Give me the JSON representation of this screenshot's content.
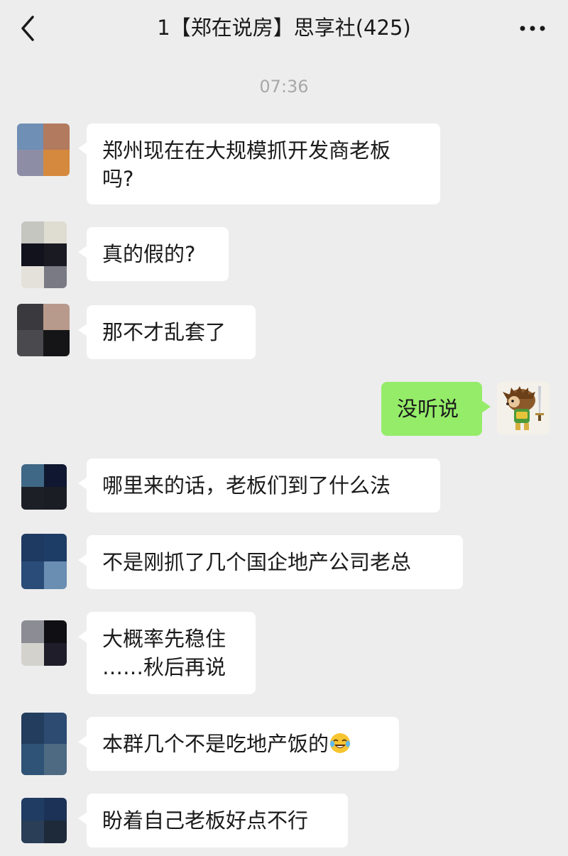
{
  "header": {
    "title": "1【郑在说房】思享社(425)",
    "back_icon": "chevron-left-icon",
    "more_icon": "more-horizontal-icon"
  },
  "timestamp": "07:36",
  "messages": [
    {
      "side": "left",
      "text": "郑州现在在大规模抓开发商老板\n吗?"
    },
    {
      "side": "left",
      "text": "真的假的?"
    },
    {
      "side": "left",
      "text": "那不才乱套了"
    },
    {
      "side": "right",
      "text": "没听说"
    },
    {
      "side": "left",
      "text": "哪里来的话，老板们到了什么法"
    },
    {
      "side": "left",
      "text": "不是刚抓了几个国企地产公司老总"
    },
    {
      "side": "left",
      "text": "大概率先稳住\n……秋后再说"
    },
    {
      "side": "left",
      "text": "本群几个不是吃地产饭的",
      "emoji": "face-with-tears-of-joy-icon"
    },
    {
      "side": "left",
      "text": "盼着自己老板好点不行"
    }
  ],
  "colors": {
    "background": "#ededed",
    "bubble_left": "#ffffff",
    "bubble_right": "#95ec69",
    "timestamp": "#a8a8a8"
  }
}
